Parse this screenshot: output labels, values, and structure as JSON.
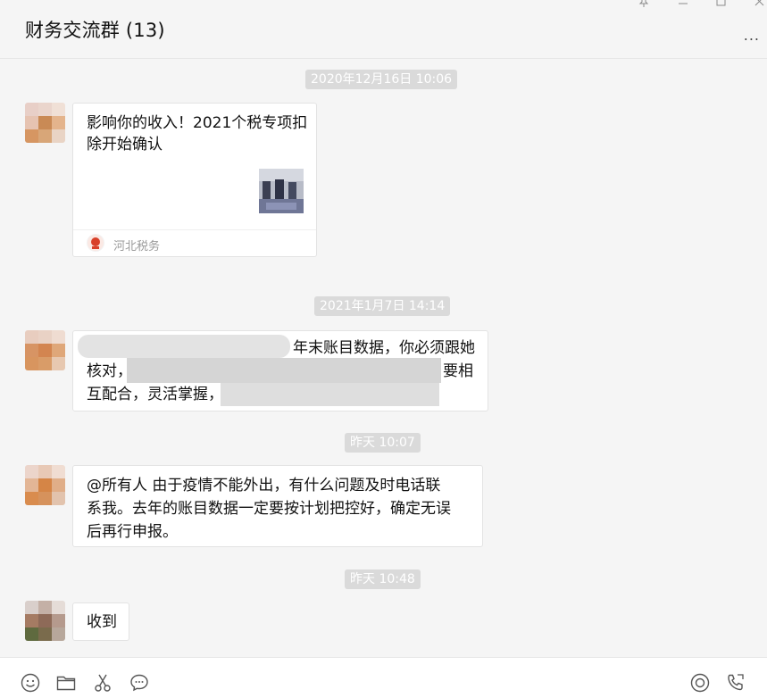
{
  "window": {
    "title": "财务交流群 (13)",
    "pin_icon": "pin-icon",
    "minimize_icon": "minimize-icon",
    "maximize_icon": "maximize-icon",
    "close_icon": "close-icon",
    "more_label": "..."
  },
  "messages": [
    {
      "timestamp": "2020年12月16日 10:06",
      "type": "link-card",
      "card_title": "影响你的收入！2021个税专项扣除开始确认",
      "source": "河北税务"
    },
    {
      "timestamp": "2021年1月7日 14:14",
      "type": "text",
      "lines": [
        "年末账目数据，你必须跟她",
        "核对，",
        "要相",
        "互配合，灵活掌握，"
      ]
    },
    {
      "timestamp": "昨天 10:07",
      "type": "text",
      "lines": [
        "@所有人  由于疫情不能外出，有什么问题及时电话联",
        "系我。去年的账目数据一定要按计划把控好，确定无误",
        "后再行申报。"
      ]
    },
    {
      "timestamp": "昨天 10:48",
      "type": "text",
      "lines": [
        "收到"
      ]
    }
  ],
  "toolbar": {
    "left_icons": [
      "emoji-icon",
      "folder-icon",
      "scissors-icon",
      "chat-bubble-icon"
    ],
    "right_icons": [
      "live-icon",
      "call-icon"
    ]
  },
  "colors": {
    "chat_background": "#f5f5f5",
    "timestamp_background": "#dadada",
    "bubble_background": "#ffffff"
  }
}
